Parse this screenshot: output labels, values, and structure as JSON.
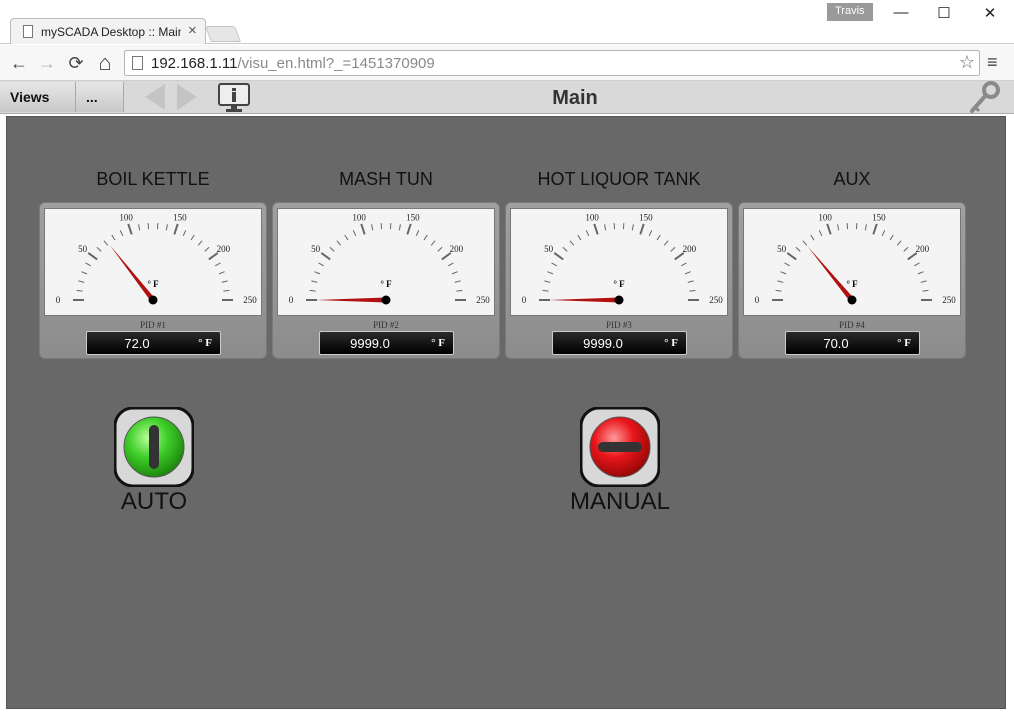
{
  "browser": {
    "tab_title": "mySCADA Desktop :: Main",
    "tab_close": "×",
    "user": "Travis",
    "minimize": "—",
    "maximize": "☐",
    "close": "✕",
    "back": "←",
    "forward": "→",
    "reload": "⟳",
    "home": "⌂",
    "url_host": "192.168.1.11",
    "url_path": "/visu_en.html?_=1451370909",
    "star": "☆",
    "menu": "≡"
  },
  "appbar": {
    "views_label": "Views",
    "more_label": "...",
    "title": "Main"
  },
  "gauges": [
    {
      "label": "BOIL KETTLE",
      "pid": "PID #1",
      "value": "72.0",
      "unit": "° F",
      "needle": 72.0
    },
    {
      "label": "MASH TUN",
      "pid": "PID #2",
      "value": "9999.0",
      "unit": "° F",
      "needle": 0
    },
    {
      "label": "HOT LIQUOR TANK",
      "pid": "PID #3",
      "value": "9999.0",
      "unit": "° F",
      "needle": 0
    },
    {
      "label": "AUX",
      "pid": "PID #4",
      "value": "70.0",
      "unit": "° F",
      "needle": 70.0
    }
  ],
  "gauge_scale": {
    "min": 0,
    "max": 250,
    "major_ticks": [
      "0",
      "50",
      "100",
      "150",
      "200",
      "250"
    ],
    "face_unit": "° F"
  },
  "switches": {
    "auto": {
      "label": "AUTO",
      "color": "#3fcf2a"
    },
    "manual": {
      "label": "MANUAL",
      "color": "#e8161b"
    }
  },
  "colors": {
    "panel": "#686868",
    "needle": "#b01010"
  }
}
